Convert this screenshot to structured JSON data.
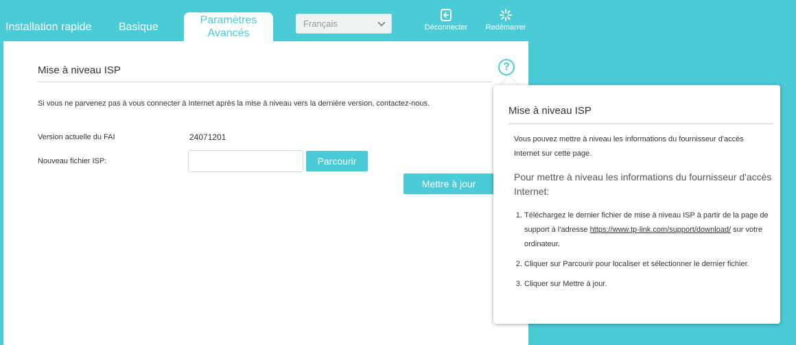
{
  "nav": {
    "quick_setup": "Installation rapide",
    "basic": "Basique",
    "advanced": "Paramètres Avancés",
    "language": "Français",
    "logout": "Déconnecter",
    "reboot": "Redémarrer"
  },
  "main": {
    "title": "Mise à niveau ISP",
    "notice": "Si vous ne parvenez pas à vous connecter à Internet après la mise à niveau vers la dernière version, contactez-nous.",
    "current_version_label": "Version actuelle du FAI",
    "current_version_value": "24071201",
    "new_file_label": "Nouveau fichier ISP:",
    "browse_label": "Parcourir",
    "update_label": "Mettre à jour",
    "help_glyph": "?"
  },
  "help": {
    "title": "Mise à niveau ISP",
    "intro": "Vous pouvez mettre à niveau les informations du fournisseur d'accès Internet sur cette page.",
    "subtitle": "Pour mettre à niveau les informations du fournisseur d'accès Internet:",
    "step1_before": "Téléchargez le dernier fichier de mise à niveau ISP à partir de la page de support à l'adresse ",
    "step1_link": "https://www.tp-link.com/support/download/",
    "step1_after": " sur votre ordinateur.",
    "step2": "Cliquer sur Parcourir pour localiser et sélectionner le dernier fichier.",
    "step3": "Cliquer sur Mettre à jour."
  },
  "colors": {
    "accent": "#4acbd6",
    "panel": "#ffffff"
  },
  "icons": {
    "logout": "logout-icon",
    "reboot": "reboot-icon",
    "help": "help-icon",
    "dropdown": "chevron-down-icon"
  }
}
